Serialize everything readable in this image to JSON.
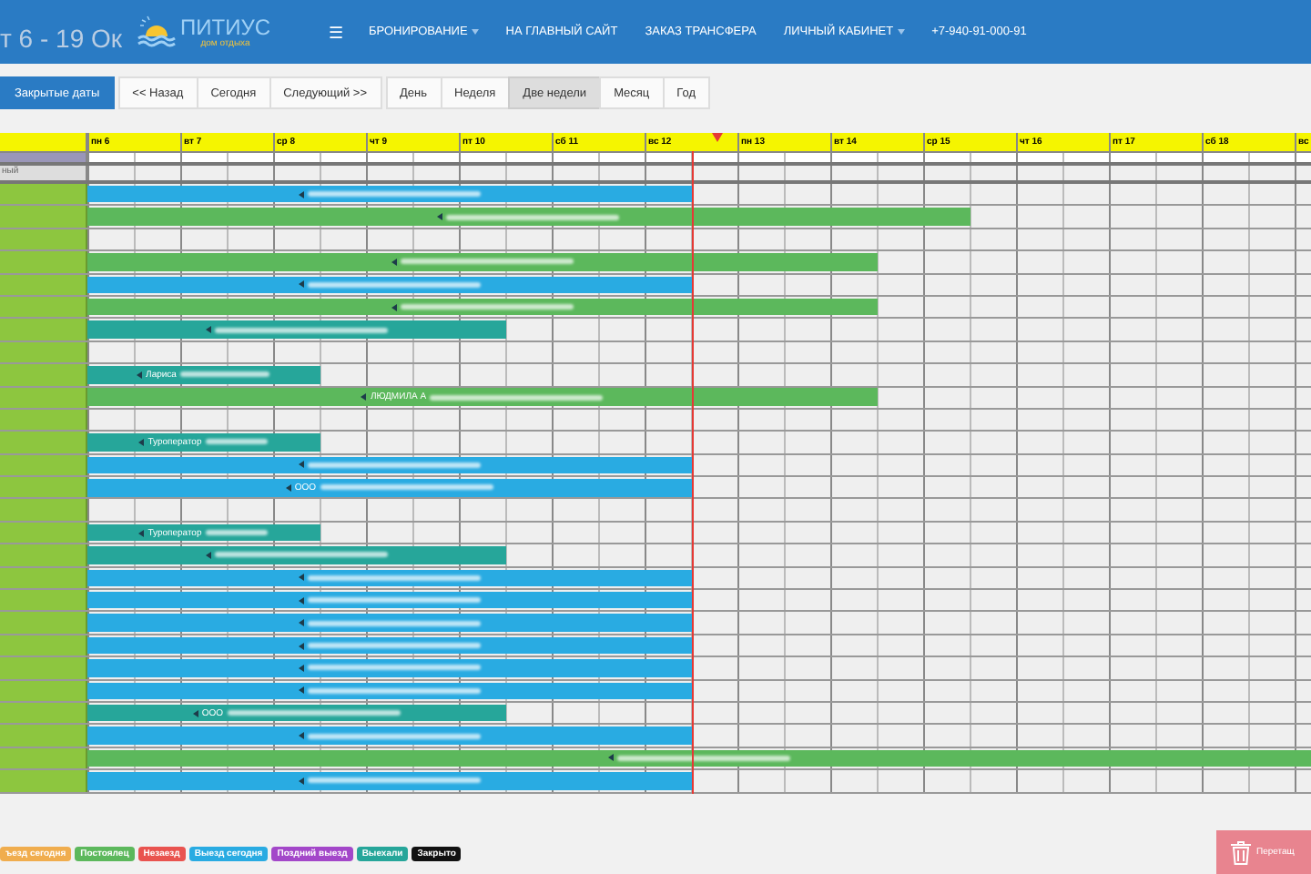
{
  "page_title": "т 6 - 19 Ок",
  "navbar": {
    "logo_title": "ПИТИУС",
    "logo_subtitle": "дом отдыха",
    "menu_icon": "☰",
    "items": [
      {
        "label": "БРОНИРОВАНИЕ",
        "dropdown": true
      },
      {
        "label": "НА ГЛАВНЫЙ САЙТ",
        "dropdown": false
      },
      {
        "label": "ЗАКАЗ ТРАНСФЕРА",
        "dropdown": false
      },
      {
        "label": "ЛИЧНЫЙ КАБИНЕТ",
        "dropdown": true
      },
      {
        "label": "+7-940-91-000-91",
        "dropdown": false
      }
    ]
  },
  "toolbar": {
    "closed_dates": "Закрытые даты",
    "nav": [
      "<< Назад",
      "Сегодня",
      "Следующий >>"
    ],
    "views": [
      {
        "label": "День",
        "selected": false
      },
      {
        "label": "Неделя",
        "selected": false
      },
      {
        "label": "Две недели",
        "selected": true
      },
      {
        "label": "Месяц",
        "selected": false
      },
      {
        "label": "Год",
        "selected": false
      }
    ]
  },
  "calendar": {
    "days": [
      {
        "label": "пн 6",
        "today": false
      },
      {
        "label": "вт 7",
        "today": false
      },
      {
        "label": "ср 8",
        "today": false
      },
      {
        "label": "чт 9",
        "today": false
      },
      {
        "label": "пт 10",
        "today": false
      },
      {
        "label": "сб 11",
        "today": false
      },
      {
        "label": "вс 12",
        "today": true
      },
      {
        "label": "пн 13",
        "today": false
      },
      {
        "label": "вт 14",
        "today": false
      },
      {
        "label": "ср 15",
        "today": false
      },
      {
        "label": "чт 16",
        "today": false
      },
      {
        "label": "пт 17",
        "today": false
      },
      {
        "label": "сб 18",
        "today": false
      },
      {
        "label": "вс"
      }
    ],
    "group_label": "ный",
    "rows": [
      {
        "kind": "booking",
        "color": "#29abe2"
      },
      {
        "kind": "booking",
        "color": "#5cb85c"
      },
      {
        "kind": "empty"
      },
      {
        "kind": "booking",
        "color": "#5cb85c"
      },
      {
        "kind": "booking",
        "color": "#29abe2"
      },
      {
        "kind": "booking",
        "color": "#5cb85c"
      },
      {
        "kind": "booking",
        "color": "#26a69a"
      },
      {
        "kind": "empty"
      },
      {
        "kind": "booking",
        "color": "#26a69a",
        "label": "Лариса"
      },
      {
        "kind": "booking",
        "color": "#5cb85c",
        "label": "ЛЮДМИЛА А"
      },
      {
        "kind": "empty"
      },
      {
        "kind": "booking",
        "color": "#26a69a",
        "label": "Туроператор"
      },
      {
        "kind": "booking",
        "color": "#29abe2"
      },
      {
        "kind": "booking",
        "color": "#29abe2",
        "label": "ООО"
      },
      {
        "kind": "empty"
      },
      {
        "kind": "booking",
        "color": "#26a69a",
        "label": "Туроператор"
      },
      {
        "kind": "booking",
        "color": "#26a69a"
      },
      {
        "kind": "booking",
        "color": "#29abe2"
      },
      {
        "kind": "booking",
        "color": "#29abe2"
      },
      {
        "kind": "booking",
        "color": "#29abe2"
      },
      {
        "kind": "booking",
        "color": "#29abe2"
      },
      {
        "kind": "booking",
        "color": "#29abe2"
      },
      {
        "kind": "booking",
        "color": "#29abe2"
      },
      {
        "kind": "booking",
        "color": "#26a69a",
        "label": "ООО"
      },
      {
        "kind": "booking",
        "color": "#29abe2"
      },
      {
        "kind": "booking",
        "color": "#5cb85c"
      },
      {
        "kind": "booking",
        "color": "#29abe2"
      }
    ]
  },
  "legend": [
    {
      "label": "ъезд сегодня",
      "color": "#f0ad4e"
    },
    {
      "label": "Постоялец",
      "color": "#5cb85c"
    },
    {
      "label": "Незаезд",
      "color": "#e9534f"
    },
    {
      "label": "Выезд сегодня",
      "color": "#29abe2"
    },
    {
      "label": "Поздний выезд",
      "color": "#a347c9"
    },
    {
      "label": "Выехали",
      "color": "#26a69a"
    },
    {
      "label": "Закрыто",
      "color": "#111111"
    }
  ],
  "trash_button": "Перетащ"
}
